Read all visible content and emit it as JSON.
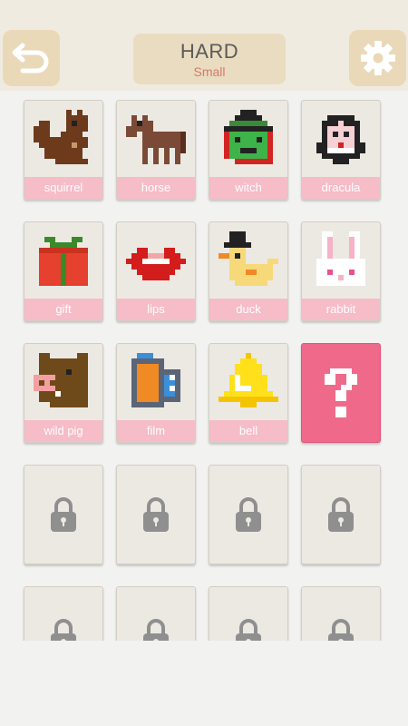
{
  "header": {
    "title": "HARD",
    "subtitle": "Small",
    "back_icon": "back-arrow-icon",
    "settings_icon": "gear-icon"
  },
  "puzzles": [
    {
      "label": "squirrel",
      "icon": "squirrel-pixel-art"
    },
    {
      "label": "horse",
      "icon": "horse-pixel-art"
    },
    {
      "label": "witch",
      "icon": "witch-pixel-art"
    },
    {
      "label": "dracula",
      "icon": "dracula-pixel-art"
    },
    {
      "label": "gift",
      "icon": "gift-pixel-art"
    },
    {
      "label": "lips",
      "icon": "lips-pixel-art"
    },
    {
      "label": "duck",
      "icon": "duck-pixel-art"
    },
    {
      "label": "rabbit",
      "icon": "rabbit-pixel-art"
    },
    {
      "label": "wild pig",
      "icon": "wild-pig-pixel-art"
    },
    {
      "label": "film",
      "icon": "film-pixel-art"
    },
    {
      "label": "bell",
      "icon": "bell-pixel-art"
    }
  ],
  "mystery": {
    "symbol": "?",
    "color": "#ef6a8a"
  },
  "locked_icon": "lock-icon",
  "colors": {
    "topbar": "#f0ebe0",
    "button": "#ead9b8",
    "label_bg": "#f6bcc8",
    "card_bg": "#ece9e3"
  }
}
